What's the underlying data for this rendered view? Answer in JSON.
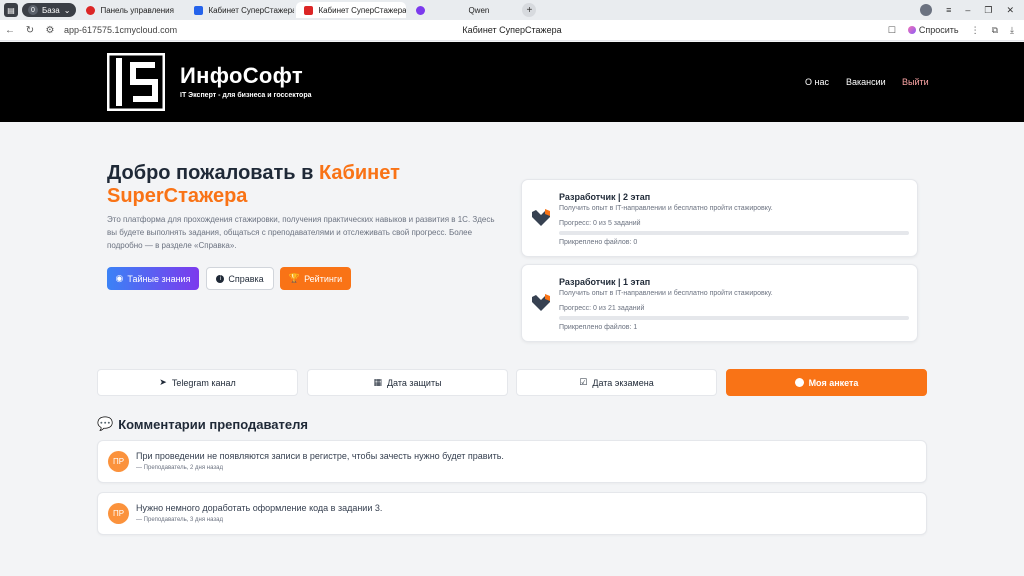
{
  "browser": {
    "workspace_label": "База",
    "workspace_count": "0",
    "tabs": [
      {
        "title": "Панель управления",
        "color": "#dc2626"
      },
      {
        "title": "Кабинет СуперСтажера",
        "color": "#2563eb"
      },
      {
        "title": "Кабинет СуперСтажера",
        "color": "#dc2626",
        "active": true
      },
      {
        "title": "Qwen",
        "color": "#7c3aed"
      }
    ],
    "url": "app-617575.1cmycloud.com",
    "page_title": "Кабинет СуперСтажера",
    "ask_label": "Спросить"
  },
  "header": {
    "brand": "ИнфоСофт",
    "tagline": "IT Эксперт - для бизнеса и госсектора",
    "nav": [
      "О нас",
      "Вакансии",
      "Выйти"
    ]
  },
  "hero": {
    "title_prefix": "Добро пожаловать в ",
    "title_accent": "Кабинет SuperСтажера",
    "text": "Это платформа для прохождения стажировки, получения практических навыков и развития в 1С. Здесь вы будете выполнять задания, общаться с преподавателями и отслеживать свой прогресс. Более подробно — в разделе «Справка».",
    "buttons": {
      "secret": "Тайные знания",
      "help": "Справка",
      "ratings": "Рейтинги"
    }
  },
  "stages": [
    {
      "title": "Разработчик | 2 этап",
      "desc": "Получить опыт в IT-направлении и бесплатно пройти стажировку.",
      "progress_text": "Прогресс: 0 из 5 заданий",
      "progress": 0,
      "files": "Прикреплено файлов: 0"
    },
    {
      "title": "Разработчик | 1 этап",
      "desc": "Получить опыт в IT-направлении и бесплатно пройти стажировку.",
      "progress_text": "Прогресс: 0 из 21 заданий",
      "progress": 0,
      "files": "Прикреплено файлов: 1"
    }
  ],
  "actions": {
    "telegram": "Telegram канал",
    "defense": "Дата защиты",
    "exam": "Дата экзамена",
    "profile": "Моя анкета"
  },
  "comments": {
    "title": "Комментарии преподавателя",
    "items": [
      {
        "initials": "ПР",
        "text": "При проведении не появляются записи в регистре, чтобы зачесть нужно будет править.",
        "meta": "— Преподаватель, 2 дня назад"
      },
      {
        "initials": "ПР",
        "text": "Нужно немного доработать оформление кода в задании 3.",
        "meta": "— Преподаватель, 3 дня назад"
      }
    ]
  },
  "colors": {
    "accent": "#f97316",
    "header_bg": "#000000",
    "page_bg": "#f3f4f6"
  }
}
